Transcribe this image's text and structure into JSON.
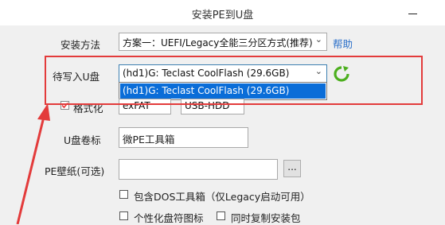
{
  "window": {
    "title": "安装PE到U盘"
  },
  "install_method": {
    "label": "安装方法",
    "value": "方案一：UEFI/Legacy全能三分区方式(推荐)",
    "help": "帮助"
  },
  "target_drive": {
    "label": "待写入U盘",
    "value": "(hd1)G: Teclast CoolFlash (29.6GB)",
    "options": [
      "(hd1)G: Teclast CoolFlash (29.6GB)"
    ]
  },
  "format": {
    "label": "格式化",
    "checked": true,
    "fs": "exFAT",
    "mode": "USB-HDD"
  },
  "volume_label": {
    "label": "U盘卷标",
    "value": "微PE工具箱"
  },
  "wallpaper": {
    "label": "PE壁纸(可选)",
    "value": "",
    "browse": "..."
  },
  "options": {
    "include_dos": "包含DOS工具箱（仅Legacy启动可用）",
    "personalize_icon": "个性化盘符图标",
    "copy_installer": "同时复制安装包"
  },
  "colors": {
    "highlight": "#e33b3b",
    "selection": "#0a6dd8",
    "link": "#2a6fc9",
    "refresh": "#4caf1e"
  }
}
